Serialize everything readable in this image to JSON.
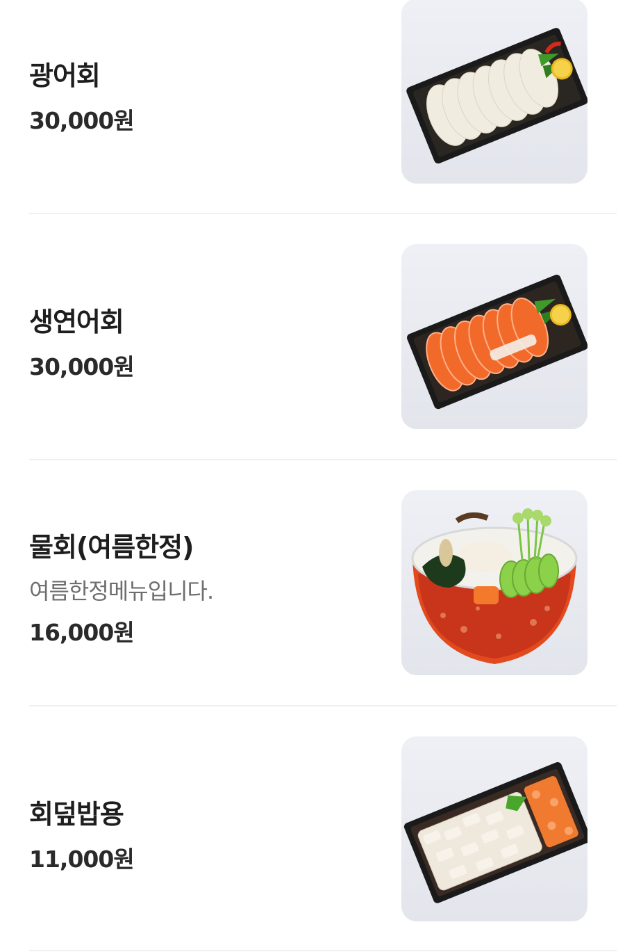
{
  "menu": {
    "items": [
      {
        "name": "광어회",
        "description": "",
        "price": "30,000원",
        "image": "flatfish-sashimi-tray"
      },
      {
        "name": "생연어회",
        "description": "",
        "price": "30,000원",
        "image": "salmon-sashimi-tray"
      },
      {
        "name": "물회(여름한정)",
        "description": "여름한정메뉴입니다.",
        "price": "16,000원",
        "image": "mulhoe-bowl"
      },
      {
        "name": "회덮밥용",
        "description": "",
        "price": "11,000원",
        "image": "hoedeopbap-sashimi-tray"
      }
    ]
  },
  "colors": {
    "divider": "#f0f0f0",
    "thumb_bg": "#e8eaf0",
    "tray_black": "#1a1a1a",
    "salmon": "#f06a2a"
  }
}
